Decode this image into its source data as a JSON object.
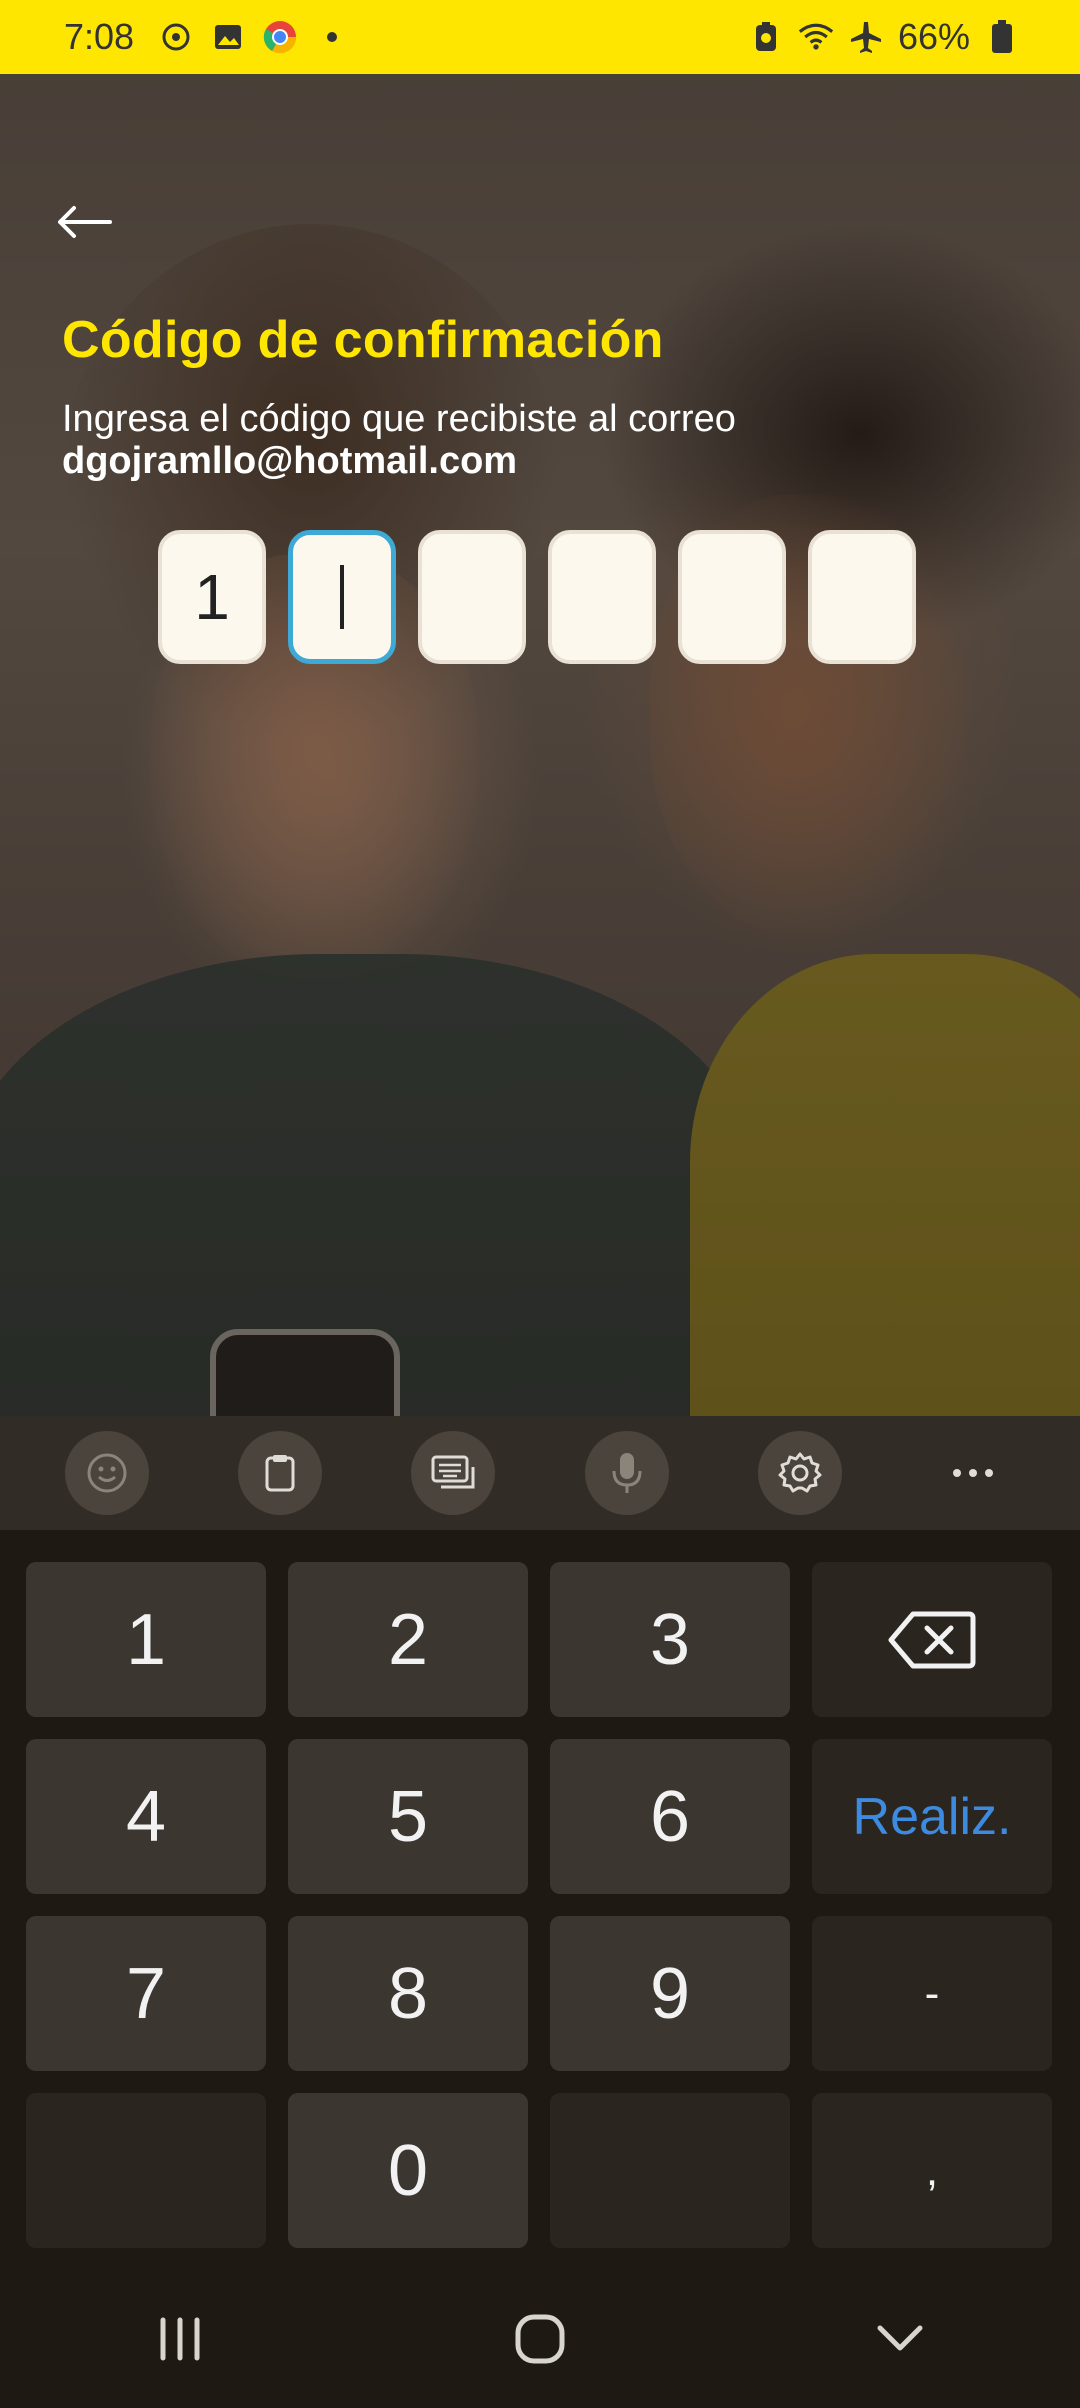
{
  "status_bar": {
    "time": "7:08",
    "battery": "66%",
    "left_icons": [
      "hotspot-icon",
      "gallery-icon",
      "chrome-icon",
      "dot-icon"
    ],
    "right_icons": [
      "battery-saver-icon",
      "wifi-icon",
      "airplane-icon",
      "battery-icon"
    ]
  },
  "screen": {
    "title": "Código de confirmación",
    "subtitle": "Ingresa el código que recibiste al correo",
    "email": "dgojramllo@hotmail.com",
    "code_digits": [
      "1",
      "",
      "",
      "",
      "",
      ""
    ],
    "active_box_index": 1
  },
  "keyboard": {
    "toolbar": [
      "emoji-icon",
      "clipboard-icon",
      "keyboard-mode-icon",
      "microphone-icon",
      "settings-icon",
      "more-icon"
    ],
    "keys": {
      "k1": "1",
      "k2": "2",
      "k3": "3",
      "k4": "4",
      "k5": "5",
      "k6": "6",
      "k7": "7",
      "k8": "8",
      "k9": "9",
      "k0": "0",
      "done": "Realiz.",
      "dash": "-",
      "comma": ","
    }
  },
  "colors": {
    "status_bar_bg": "#ffe600",
    "title": "#ffe600",
    "active_border": "#3fa9d6",
    "done_key": "#3d8be0"
  }
}
